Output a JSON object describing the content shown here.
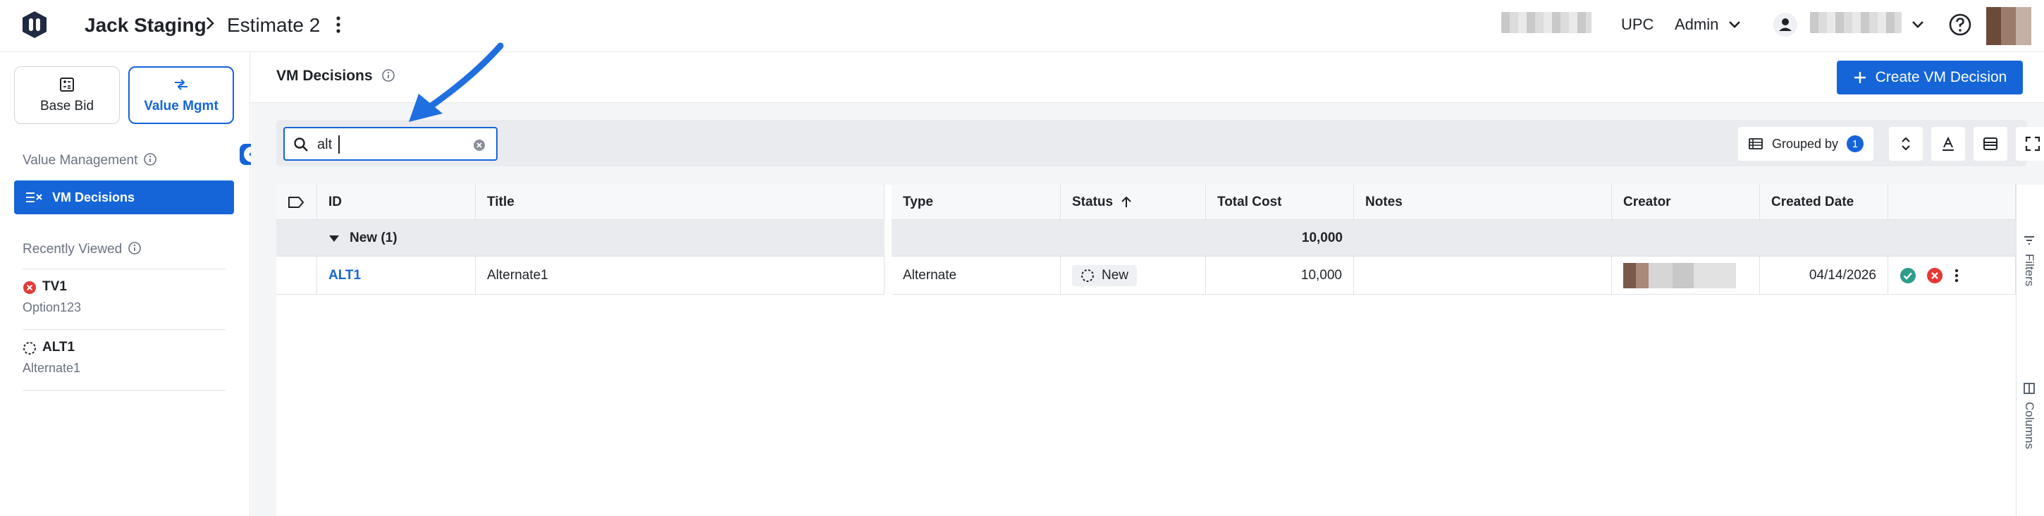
{
  "topbar": {
    "project": "Jack Staging",
    "estimate": "Estimate 2",
    "upc": "UPC",
    "role": "Admin"
  },
  "sidebar": {
    "modes": [
      {
        "label": "Base Bid",
        "icon": "calculator-icon"
      },
      {
        "label": "Value Mgmt",
        "icon": "swap-arrows-icon"
      }
    ],
    "value_management_label": "Value Management",
    "active_item": "VM Decisions",
    "recently_viewed_label": "Recently Viewed",
    "recent": [
      {
        "id": "TV1",
        "subtitle": "Option123",
        "status_icon": "rejected-icon"
      },
      {
        "id": "ALT1",
        "subtitle": "Alternate1",
        "status_icon": "new-status-icon"
      }
    ]
  },
  "main": {
    "title": "VM Decisions",
    "create_button": "Create VM Decision",
    "search": {
      "value": "alt"
    },
    "grouped_by": {
      "label": "Grouped by",
      "count": "1"
    }
  },
  "grid": {
    "columns": [
      "ID",
      "Title",
      "Type",
      "Status",
      "Total Cost",
      "Notes",
      "Creator",
      "Created Date"
    ],
    "group": {
      "label": "New (1)",
      "total": "10,000"
    },
    "rows": [
      {
        "id": "ALT1",
        "title": "Alternate1",
        "type": "Alternate",
        "status": "New",
        "total_cost": "10,000",
        "notes": "",
        "created_date": "04/14/2026"
      }
    ],
    "side_tabs": [
      "Filters",
      "Columns"
    ]
  },
  "colors": {
    "accent": "#1565d8",
    "approve": "#2e9d8a",
    "reject": "#e53935"
  }
}
